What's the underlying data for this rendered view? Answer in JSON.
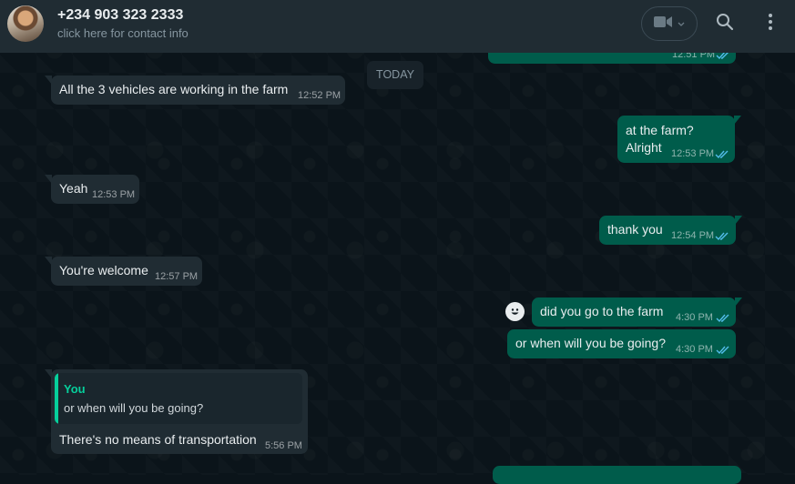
{
  "header": {
    "contact_name": "+234 903 323 2333",
    "contact_subtitle": "click here for contact info",
    "icons": [
      "video-icon",
      "chevron-down-icon",
      "search-icon",
      "menu-icon"
    ]
  },
  "date_divider": "TODAY",
  "messages": [
    {
      "id": "m0",
      "direction": "out",
      "text": "",
      "time": "12:51 PM",
      "status": "read"
    },
    {
      "id": "m1",
      "direction": "in",
      "text": "All the 3 vehicles are working in the farm",
      "time": "12:52 PM"
    },
    {
      "id": "m2",
      "direction": "out",
      "lines": [
        "at the farm?",
        "Alright"
      ],
      "time": "12:53 PM",
      "status": "read"
    },
    {
      "id": "m3",
      "direction": "in",
      "text": "Yeah",
      "time": "12:53 PM"
    },
    {
      "id": "m4",
      "direction": "out",
      "text": "thank you",
      "time": "12:54 PM",
      "status": "read"
    },
    {
      "id": "m5",
      "direction": "in",
      "text": "You're welcome",
      "time": "12:57 PM"
    },
    {
      "id": "m6",
      "direction": "out",
      "text": "did you go to the farm",
      "time": "4:30 PM",
      "status": "read"
    },
    {
      "id": "m7",
      "direction": "out",
      "text": "or when will you be going?",
      "time": "4:30 PM",
      "status": "read"
    },
    {
      "id": "m8",
      "direction": "in",
      "reply_to": {
        "author": "You",
        "text": "or when will you be going?"
      },
      "text": "There's no means of transportation",
      "time": "5:56 PM"
    }
  ],
  "colors": {
    "accent": "#06cf9c",
    "ticks": "#53bdeb",
    "bubble_out": "#005c4b",
    "bubble_in": "#202c33"
  }
}
